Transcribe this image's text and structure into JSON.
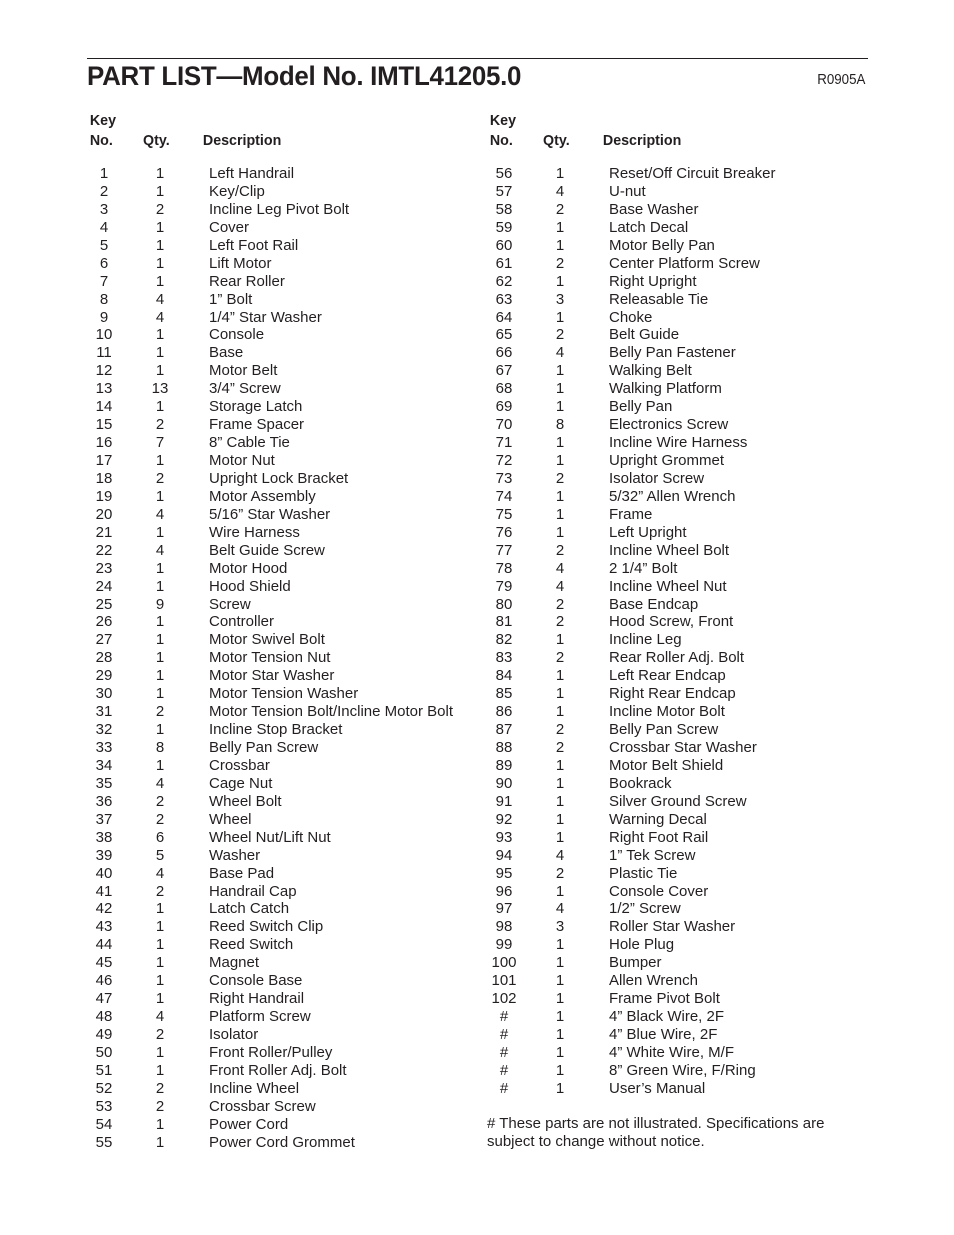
{
  "header": {
    "title": "PART LIST—Model No. IMTL41205.0",
    "code": "R0905A"
  },
  "columns": {
    "key_label_1": "Key",
    "key_label_2": "No.",
    "qty_label": "Qty.",
    "desc_label": "Description"
  },
  "left_parts": [
    {
      "key": "1",
      "qty": "1",
      "desc": "Left Handrail"
    },
    {
      "key": "2",
      "qty": "1",
      "desc": "Key/Clip"
    },
    {
      "key": "3",
      "qty": "2",
      "desc": "Incline Leg Pivot Bolt"
    },
    {
      "key": "4",
      "qty": "1",
      "desc": "Cover"
    },
    {
      "key": "5",
      "qty": "1",
      "desc": "Left Foot Rail"
    },
    {
      "key": "6",
      "qty": "1",
      "desc": "Lift Motor"
    },
    {
      "key": "7",
      "qty": "1",
      "desc": "Rear Roller"
    },
    {
      "key": "8",
      "qty": "4",
      "desc": "1” Bolt"
    },
    {
      "key": "9",
      "qty": "4",
      "desc": "1/4” Star Washer"
    },
    {
      "key": "10",
      "qty": "1",
      "desc": "Console"
    },
    {
      "key": "11",
      "qty": "1",
      "desc": "Base"
    },
    {
      "key": "12",
      "qty": "1",
      "desc": "Motor Belt"
    },
    {
      "key": "13",
      "qty": "13",
      "desc": "3/4” Screw"
    },
    {
      "key": "14",
      "qty": "1",
      "desc": "Storage Latch"
    },
    {
      "key": "15",
      "qty": "2",
      "desc": "Frame Spacer"
    },
    {
      "key": "16",
      "qty": "7",
      "desc": "8” Cable Tie"
    },
    {
      "key": "17",
      "qty": "1",
      "desc": "Motor Nut"
    },
    {
      "key": "18",
      "qty": "2",
      "desc": "Upright Lock Bracket"
    },
    {
      "key": "19",
      "qty": "1",
      "desc": "Motor Assembly"
    },
    {
      "key": "20",
      "qty": "4",
      "desc": "5/16” Star Washer"
    },
    {
      "key": "21",
      "qty": "1",
      "desc": "Wire Harness"
    },
    {
      "key": "22",
      "qty": "4",
      "desc": "Belt Guide Screw"
    },
    {
      "key": "23",
      "qty": "1",
      "desc": "Motor Hood"
    },
    {
      "key": "24",
      "qty": "1",
      "desc": "Hood Shield"
    },
    {
      "key": "25",
      "qty": "9",
      "desc": "Screw"
    },
    {
      "key": "26",
      "qty": "1",
      "desc": "Controller"
    },
    {
      "key": "27",
      "qty": "1",
      "desc": "Motor Swivel Bolt"
    },
    {
      "key": "28",
      "qty": "1",
      "desc": "Motor Tension Nut"
    },
    {
      "key": "29",
      "qty": "1",
      "desc": "Motor Star Washer"
    },
    {
      "key": "30",
      "qty": "1",
      "desc": "Motor Tension Washer"
    },
    {
      "key": "31",
      "qty": "2",
      "desc": "Motor Tension Bolt/Incline Motor Bolt"
    },
    {
      "key": "32",
      "qty": "1",
      "desc": "Incline Stop Bracket"
    },
    {
      "key": "33",
      "qty": "8",
      "desc": "Belly Pan Screw"
    },
    {
      "key": "34",
      "qty": "1",
      "desc": "Crossbar"
    },
    {
      "key": "35",
      "qty": "4",
      "desc": "Cage Nut"
    },
    {
      "key": "36",
      "qty": "2",
      "desc": "Wheel Bolt"
    },
    {
      "key": "37",
      "qty": "2",
      "desc": "Wheel"
    },
    {
      "key": "38",
      "qty": "6",
      "desc": "Wheel Nut/Lift Nut"
    },
    {
      "key": "39",
      "qty": "5",
      "desc": "Washer"
    },
    {
      "key": "40",
      "qty": "4",
      "desc": "Base Pad"
    },
    {
      "key": "41",
      "qty": "2",
      "desc": "Handrail Cap"
    },
    {
      "key": "42",
      "qty": "1",
      "desc": "Latch Catch"
    },
    {
      "key": "43",
      "qty": "1",
      "desc": "Reed Switch Clip"
    },
    {
      "key": "44",
      "qty": "1",
      "desc": "Reed Switch"
    },
    {
      "key": "45",
      "qty": "1",
      "desc": "Magnet"
    },
    {
      "key": "46",
      "qty": "1",
      "desc": "Console Base"
    },
    {
      "key": "47",
      "qty": "1",
      "desc": "Right Handrail"
    },
    {
      "key": "48",
      "qty": "4",
      "desc": "Platform Screw"
    },
    {
      "key": "49",
      "qty": "2",
      "desc": "Isolator"
    },
    {
      "key": "50",
      "qty": "1",
      "desc": "Front Roller/Pulley"
    },
    {
      "key": "51",
      "qty": "1",
      "desc": "Front Roller Adj. Bolt"
    },
    {
      "key": "52",
      "qty": "2",
      "desc": "Incline Wheel"
    },
    {
      "key": "53",
      "qty": "2",
      "desc": "Crossbar Screw"
    },
    {
      "key": "54",
      "qty": "1",
      "desc": "Power Cord"
    },
    {
      "key": "55",
      "qty": "1",
      "desc": "Power Cord Grommet"
    }
  ],
  "right_parts": [
    {
      "key": "56",
      "qty": "1",
      "desc": "Reset/Off Circuit Breaker"
    },
    {
      "key": "57",
      "qty": "4",
      "desc": "U-nut"
    },
    {
      "key": "58",
      "qty": "2",
      "desc": "Base Washer"
    },
    {
      "key": "59",
      "qty": "1",
      "desc": "Latch Decal"
    },
    {
      "key": "60",
      "qty": "1",
      "desc": "Motor Belly Pan"
    },
    {
      "key": "61",
      "qty": "2",
      "desc": "Center Platform Screw"
    },
    {
      "key": "62",
      "qty": "1",
      "desc": "Right Upright"
    },
    {
      "key": "63",
      "qty": "3",
      "desc": "Releasable Tie"
    },
    {
      "key": "64",
      "qty": "1",
      "desc": "Choke"
    },
    {
      "key": "65",
      "qty": "2",
      "desc": "Belt Guide"
    },
    {
      "key": "66",
      "qty": "4",
      "desc": "Belly Pan Fastener"
    },
    {
      "key": "67",
      "qty": "1",
      "desc": "Walking Belt"
    },
    {
      "key": "68",
      "qty": "1",
      "desc": "Walking Platform"
    },
    {
      "key": "69",
      "qty": "1",
      "desc": "Belly Pan"
    },
    {
      "key": "70",
      "qty": "8",
      "desc": "Electronics Screw"
    },
    {
      "key": "71",
      "qty": "1",
      "desc": "Incline Wire Harness"
    },
    {
      "key": "72",
      "qty": "1",
      "desc": "Upright Grommet"
    },
    {
      "key": "73",
      "qty": "2",
      "desc": "Isolator Screw"
    },
    {
      "key": "74",
      "qty": "1",
      "desc": "5/32” Allen Wrench"
    },
    {
      "key": "75",
      "qty": "1",
      "desc": "Frame"
    },
    {
      "key": "76",
      "qty": "1",
      "desc": "Left Upright"
    },
    {
      "key": "77",
      "qty": "2",
      "desc": "Incline Wheel Bolt"
    },
    {
      "key": "78",
      "qty": "4",
      "desc": "2 1/4” Bolt"
    },
    {
      "key": "79",
      "qty": "4",
      "desc": "Incline Wheel Nut"
    },
    {
      "key": "80",
      "qty": "2",
      "desc": "Base Endcap"
    },
    {
      "key": "81",
      "qty": "2",
      "desc": "Hood Screw, Front"
    },
    {
      "key": "82",
      "qty": "1",
      "desc": "Incline Leg"
    },
    {
      "key": "83",
      "qty": "2",
      "desc": "Rear Roller Adj. Bolt"
    },
    {
      "key": "84",
      "qty": "1",
      "desc": "Left Rear Endcap"
    },
    {
      "key": "85",
      "qty": "1",
      "desc": "Right Rear Endcap"
    },
    {
      "key": "86",
      "qty": "1",
      "desc": "Incline Motor Bolt"
    },
    {
      "key": "87",
      "qty": "2",
      "desc": "Belly Pan Screw"
    },
    {
      "key": "88",
      "qty": "2",
      "desc": "Crossbar Star Washer"
    },
    {
      "key": "89",
      "qty": "1",
      "desc": "Motor Belt Shield"
    },
    {
      "key": "90",
      "qty": "1",
      "desc": "Bookrack"
    },
    {
      "key": "91",
      "qty": "1",
      "desc": "Silver Ground Screw"
    },
    {
      "key": "92",
      "qty": "1",
      "desc": "Warning Decal"
    },
    {
      "key": "93",
      "qty": "1",
      "desc": "Right Foot Rail"
    },
    {
      "key": "94",
      "qty": "4",
      "desc": "1” Tek Screw"
    },
    {
      "key": "95",
      "qty": "2",
      "desc": "Plastic Tie"
    },
    {
      "key": "96",
      "qty": "1",
      "desc": "Console Cover"
    },
    {
      "key": "97",
      "qty": "4",
      "desc": "1/2” Screw"
    },
    {
      "key": "98",
      "qty": "3",
      "desc": "Roller Star Washer"
    },
    {
      "key": "99",
      "qty": "1",
      "desc": "Hole Plug"
    },
    {
      "key": "100",
      "qty": "1",
      "desc": "Bumper"
    },
    {
      "key": "101",
      "qty": "1",
      "desc": "Allen Wrench"
    },
    {
      "key": "102",
      "qty": "1",
      "desc": "Frame Pivot Bolt"
    },
    {
      "key": "#",
      "qty": "1",
      "desc": "4” Black Wire, 2F"
    },
    {
      "key": "#",
      "qty": "1",
      "desc": "4” Blue Wire, 2F"
    },
    {
      "key": "#",
      "qty": "1",
      "desc": "4” White Wire, M/F"
    },
    {
      "key": "#",
      "qty": "1",
      "desc": "8” Green Wire, F/Ring"
    },
    {
      "key": "#",
      "qty": "1",
      "desc": "User’s Manual"
    }
  ],
  "footnote": "# These parts are not illustrated. Specifications are subject to change without notice."
}
